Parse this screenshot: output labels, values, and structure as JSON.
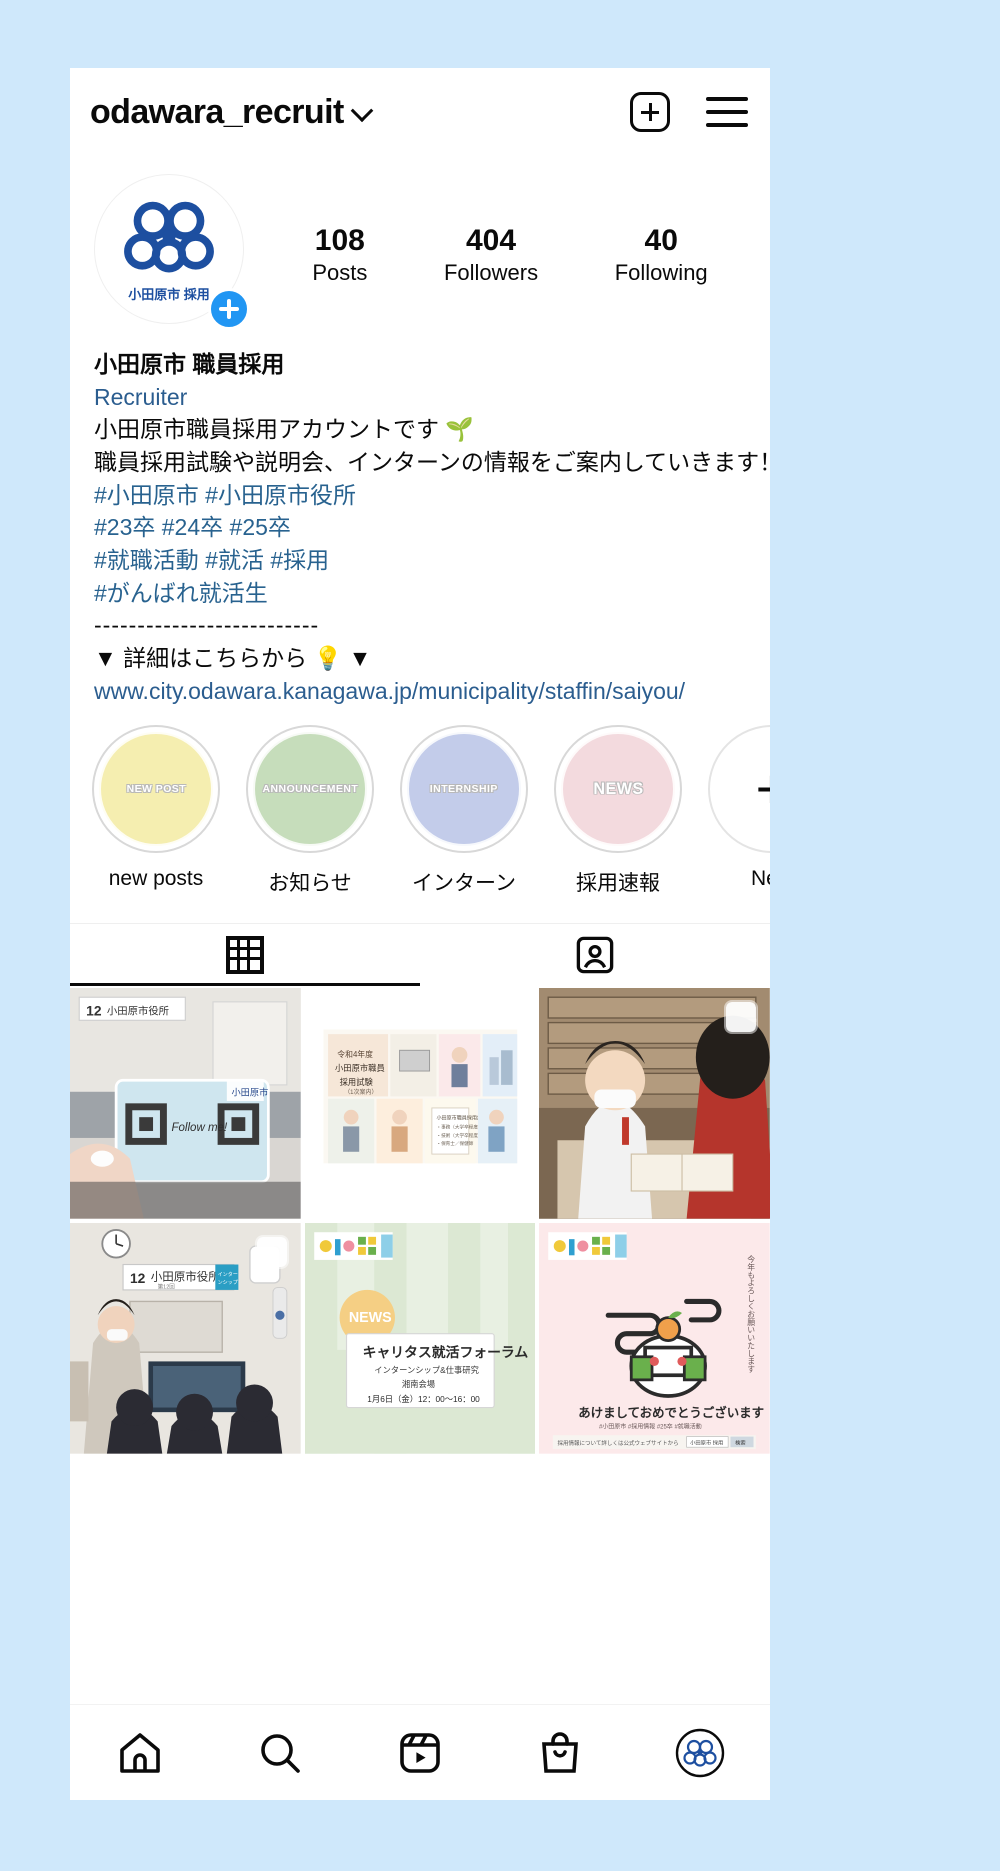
{
  "header": {
    "username": "odawara_recruit",
    "chevron_icon": "chevron-down-icon",
    "add_icon": "plus-square-icon",
    "menu_icon": "hamburger-menu-icon"
  },
  "profile": {
    "avatar_caption": "小田原市 採用",
    "add_story_icon": "add-story-plus-icon",
    "stats": [
      {
        "value": "108",
        "label": "Posts"
      },
      {
        "value": "404",
        "label": "Followers"
      },
      {
        "value": "40",
        "label": "Following"
      }
    ]
  },
  "bio": {
    "display_name": "小田原市 職員採用",
    "category": "Recruiter",
    "lines": [
      "小田原市職員採用アカウントです 🌱",
      "職員採用試験や説明会、インターンの情報をご案内していきます！"
    ],
    "hashtag_lines": [
      "#小田原市 #小田原市役所",
      "#23卒 #24卒 #25卒",
      "#就職活動 #就活 #採用",
      "#がんばれ就活生"
    ],
    "divider": "--------------------------",
    "detail_line": "▼ 詳細はこちらから 💡 ▼",
    "link": "www.city.odawara.kanagawa.jp/municipality/staffin/saiyou/"
  },
  "highlights": [
    {
      "label": "new posts",
      "cover_text": "NEW POST",
      "color": "#f5eeb0"
    },
    {
      "label": "お知らせ",
      "cover_text": "ANNOUNCEMENT",
      "color": "#c6ddbb"
    },
    {
      "label": "インターン",
      "cover_text": "INTERNSHIP",
      "color": "#c3ccea"
    },
    {
      "label": "採用速報",
      "cover_text": "NEWS",
      "color": "#f3dade"
    },
    {
      "label": "New",
      "cover_text": "+",
      "color": "#ffffff"
    }
  ],
  "tabs": [
    {
      "name": "grid-tab",
      "icon": "grid-icon",
      "active": true
    },
    {
      "name": "tagged-tab",
      "icon": "tagged-icon",
      "active": false
    }
  ],
  "posts": [
    {
      "id": "post-qr-followme",
      "caption": "Follow me!",
      "badge_number": "12",
      "sign_text": "小田原市役所",
      "has_multi": false
    },
    {
      "id": "post-exam-flyer",
      "caption": "令和4年度 小田原市職員 採用試験 (1次案内)",
      "has_multi": false
    },
    {
      "id": "post-desk-interview",
      "caption": "",
      "has_multi": true
    },
    {
      "id": "post-presentation",
      "caption": "小田原市役所",
      "badge_number": "12",
      "has_multi": true
    },
    {
      "id": "post-career-forum",
      "badge_text": "NEWS",
      "title": "キャリタス就活フォーラム",
      "sub1": "インターンシップ&仕事研究",
      "sub2": "湘南会場",
      "sub3": "1月6日（金）12：00〜16：00",
      "has_multi": false
    },
    {
      "id": "post-new-year",
      "title": "あけましておめでとうございます",
      "sub1": "#小田原市 #採用情報 #25卒 #就職活動",
      "sub2": "採用情報について詳しくは公式ウェブサイトから",
      "side_text": "今年もよろしくお願いいたします",
      "tag1": "小田原市 採用",
      "tag2": "検索",
      "has_multi": false
    }
  ],
  "bottom_nav": [
    {
      "name": "home",
      "icon": "home-icon"
    },
    {
      "name": "search",
      "icon": "search-icon"
    },
    {
      "name": "reels",
      "icon": "reels-icon"
    },
    {
      "name": "shop",
      "icon": "shop-bag-icon"
    },
    {
      "name": "profile",
      "icon": "profile-avatar-icon"
    }
  ],
  "colors": {
    "page_background": "#cfe8fb",
    "link": "#2b5d8f",
    "accent_blue": "#2196f3"
  }
}
